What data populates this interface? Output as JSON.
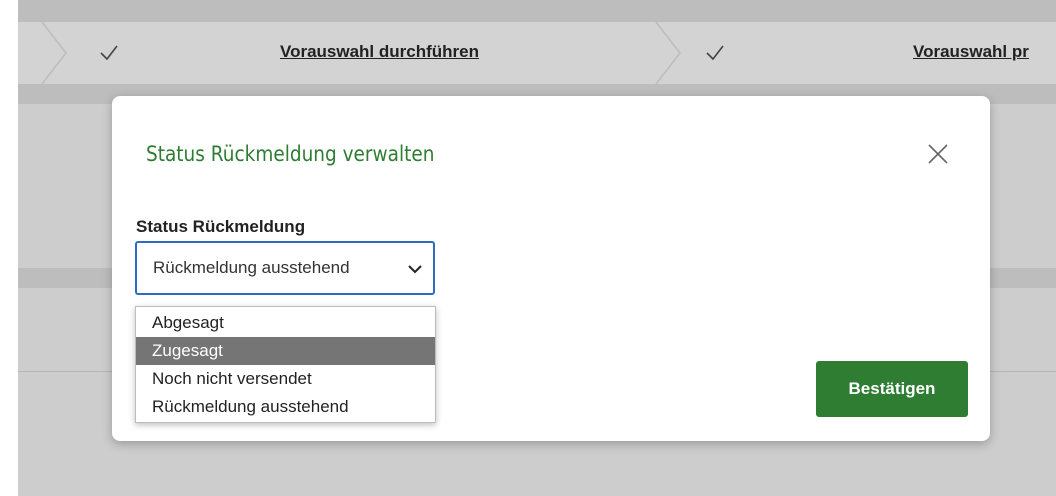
{
  "stepper": {
    "steps": [
      {
        "label": "Vorauswahl durchführen",
        "completed": true
      },
      {
        "label": "Vorauswahl pr",
        "completed": true
      }
    ]
  },
  "modal": {
    "title": "Status Rückmeldung verwalten",
    "close_icon": "close-icon",
    "field_label": "Status Rückmeldung",
    "select": {
      "value": "Rückmeldung ausstehend",
      "icon": "chevron-down-icon",
      "options": [
        {
          "label": "Abgesagt",
          "highlighted": false
        },
        {
          "label": "Zugesagt",
          "highlighted": true
        },
        {
          "label": "Noch nicht versendet",
          "highlighted": false
        },
        {
          "label": "Rückmeldung ausstehend",
          "highlighted": false
        }
      ]
    },
    "confirm_label": "Bestätigen"
  },
  "colors": {
    "accent_green": "#2e7d32",
    "focus_blue": "#2f6cc0",
    "option_highlight": "#757575",
    "overlay": "#cdcdcd"
  }
}
